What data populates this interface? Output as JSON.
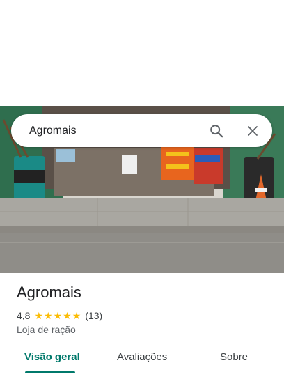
{
  "search": {
    "value": "Agromais"
  },
  "place": {
    "name": "Agromais",
    "rating": "4,8",
    "review_count": "(13)",
    "category": "Loja de ração"
  },
  "tabs": [
    {
      "label": "Visão geral",
      "active": true
    },
    {
      "label": "Avaliações",
      "active": false
    },
    {
      "label": "Sobre",
      "active": false
    }
  ],
  "colors": {
    "accent": "#00796b",
    "star": "#fbbc04"
  },
  "icons": [
    "search-icon",
    "close-icon",
    "star-icon"
  ]
}
